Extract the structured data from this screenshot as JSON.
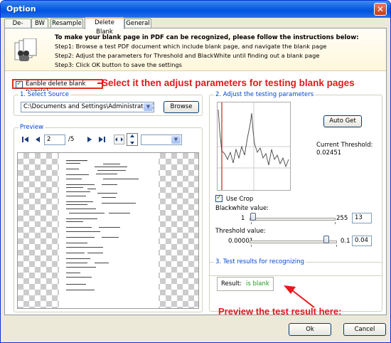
{
  "window": {
    "title": "Option",
    "close_glyph": "✕"
  },
  "tabs": [
    {
      "label": "De-Skew"
    },
    {
      "label": "BW"
    },
    {
      "label": "Resample"
    },
    {
      "label": "Delete Blank"
    },
    {
      "label": "General"
    }
  ],
  "active_tab": "Delete Blank",
  "instructions": {
    "heading": "To make your blank page in PDF can be recognized, please follow the instructions below:",
    "steps": [
      "Step1: Browse a test PDF document which include blank page, and navigate the blank page",
      "Step2: Adjust the parameters for Threshold and BlackWhite until finding out a blank page",
      "Step3: Click OK button to save the settings"
    ],
    "icon": "documents-icon"
  },
  "enable_checkbox": {
    "label": "Eanble delete blank page(s)",
    "checked": true
  },
  "callouts": {
    "top": "Select it then adjust parameters for testing blank pages",
    "bottom": "Preview the test result here:"
  },
  "select_source": {
    "title": "1. Select Source",
    "path": "C:\\Documents and Settings\\Administrator\\Desk",
    "browse_label": "Browse"
  },
  "preview": {
    "title": "Preview",
    "page_value": "2",
    "page_total": "/5"
  },
  "adjust": {
    "title": "2. Adjust the testing parameters",
    "auto_get_label": "Auto Get",
    "current_threshold_label": "Current Threshold:",
    "current_threshold_value": "0.02451",
    "use_crop_label": "Use Crop",
    "use_crop_checked": true,
    "blackwhite": {
      "label": "Blackwhite  value:",
      "min": "1",
      "max": "255",
      "value": "13",
      "fraction": 0.047
    },
    "threshold": {
      "label": "Threshold value:",
      "min": "0.00001",
      "max": "0.1",
      "value": "0.04",
      "fraction": 0.85
    }
  },
  "results": {
    "title": "3. Test results for recognizing",
    "result_label": "Result:",
    "result_value": "is blank",
    "result_color": "#1f9a1f"
  },
  "footer": {
    "ok_label": "Ok",
    "cancel_label": "Cancel"
  },
  "colors": {
    "title_bar": "#0054e3",
    "callout": "#e8161e",
    "group_title": "#0046d5"
  }
}
